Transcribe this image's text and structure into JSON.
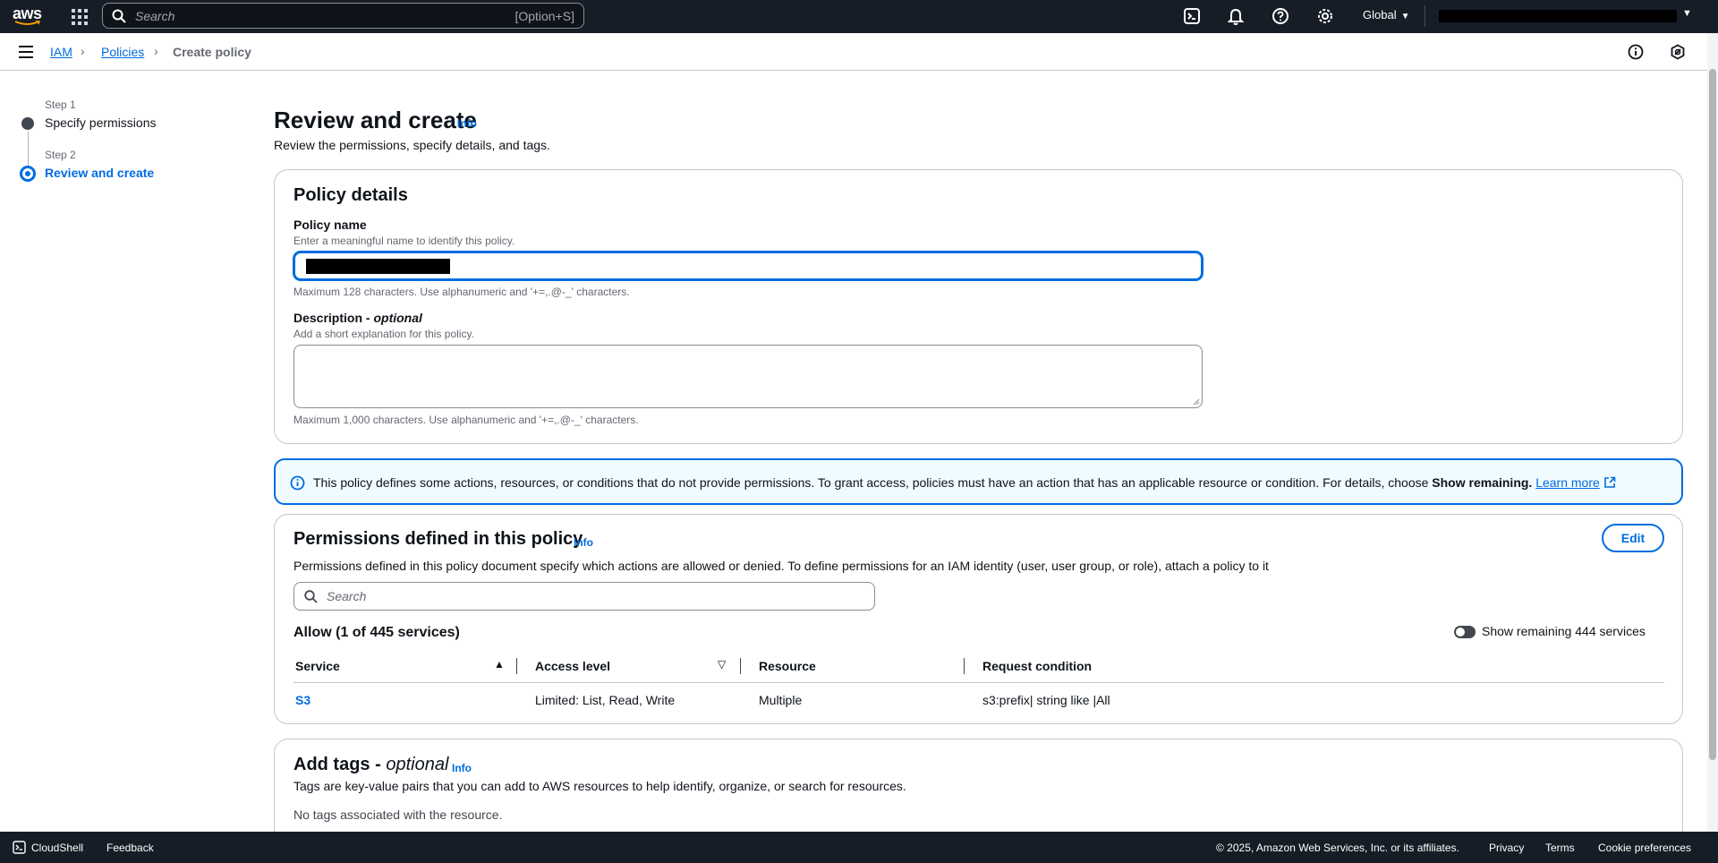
{
  "topnav": {
    "logo_text": "aws",
    "search_placeholder": "Search",
    "search_shortcut": "[Option+S]",
    "region": "Global",
    "icons": [
      "cloudshell-icon",
      "bell-icon",
      "help-icon",
      "gear-icon"
    ]
  },
  "breadcrumb": {
    "items": [
      "IAM",
      "Policies",
      "Create policy"
    ]
  },
  "stepper": {
    "steps": [
      {
        "label": "Step 1",
        "title": "Specify permissions"
      },
      {
        "label": "Step 2",
        "title": "Review and create"
      }
    ]
  },
  "header": {
    "title": "Review and create",
    "info": "Info",
    "description": "Review the permissions, specify details, and tags."
  },
  "policy_details": {
    "title": "Policy details",
    "name_label": "Policy name",
    "name_desc": "Enter a meaningful name to identify this policy.",
    "name_hint": "Maximum 128 characters. Use alphanumeric and '+=,.@-_' characters.",
    "desc_label": "Description - ",
    "desc_label_optional": "optional",
    "desc_desc": "Add a short explanation for this policy.",
    "desc_hint": "Maximum 1,000 characters. Use alphanumeric and '+=,.@-_' characters."
  },
  "alert": {
    "text": "This policy defines some actions, resources, or conditions that do not provide permissions. To grant access, policies must have an action that has an applicable resource or condition. For details, choose ",
    "bold": "Show remaining.",
    "link": "Learn more"
  },
  "permissions": {
    "title": "Permissions defined in this policy",
    "info": "Info",
    "edit": "Edit",
    "description": "Permissions defined in this policy document specify which actions are allowed or denied. To define permissions for an IAM identity (user, user group, or role), attach a policy to it",
    "search_placeholder": "Search",
    "allow_title": "Allow (1 of 445 services)",
    "toggle_label": "Show remaining 444 services",
    "columns": [
      "Service",
      "Access level",
      "Resource",
      "Request condition"
    ],
    "rows": [
      {
        "service": "S3",
        "access": "Limited: List, Read, Write",
        "resource": "Multiple",
        "condition": "s3:prefix| string like |All"
      }
    ]
  },
  "tags": {
    "title": "Add tags - ",
    "title_optional": "optional",
    "info": "Info",
    "description": "Tags are key-value pairs that you can add to AWS resources to help identify, organize, or search for resources.",
    "empty": "No tags associated with the resource."
  },
  "footer": {
    "cloudshell": "CloudShell",
    "feedback": "Feedback",
    "copyright": "© 2025, Amazon Web Services, Inc. or its affiliates.",
    "privacy": "Privacy",
    "terms": "Terms",
    "cookies": "Cookie preferences"
  },
  "colors": {
    "nav_bg": "#161d26",
    "link": "#006ce0",
    "alert_bg": "#f0fbff"
  }
}
